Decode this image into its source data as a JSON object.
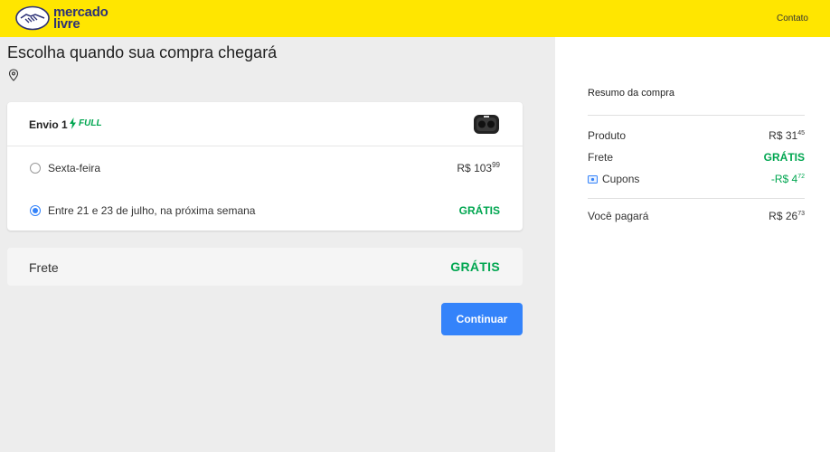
{
  "header": {
    "logo_line1": "mercado",
    "logo_line2": "livre",
    "contact_link": "Contato",
    "brand_color": "#ffe600"
  },
  "main": {
    "title": "Escolha quando sua compra chegará",
    "location_icon": "map-pin-icon",
    "shipment": {
      "label": "Envio 1",
      "badge_text": "FULL",
      "badge_icon": "lightning-icon",
      "options": [
        {
          "label": "Sexta-feira",
          "price_main": "R$ 103",
          "price_cents": "99",
          "selected": false
        },
        {
          "label": "Entre 21 e 23 de julho, na próxima semana",
          "price_text": "GRÁTIS",
          "selected": true
        }
      ]
    },
    "frete": {
      "label": "Frete",
      "value": "GRÁTIS"
    },
    "continue_label": "Continuar"
  },
  "summary": {
    "title": "Resumo da compra",
    "rows": [
      {
        "label": "Produto",
        "value_main": "R$ 31",
        "value_cents": "45"
      },
      {
        "label": "Frete",
        "value_text": "GRÁTIS"
      },
      {
        "label": "Cupons",
        "value_main": "-R$ 4",
        "value_cents": "72"
      }
    ],
    "total": {
      "label": "Você pagará",
      "value_main": "R$ 26",
      "value_cents": "73"
    }
  },
  "colors": {
    "accent": "#3483fa",
    "success": "#00a650"
  }
}
